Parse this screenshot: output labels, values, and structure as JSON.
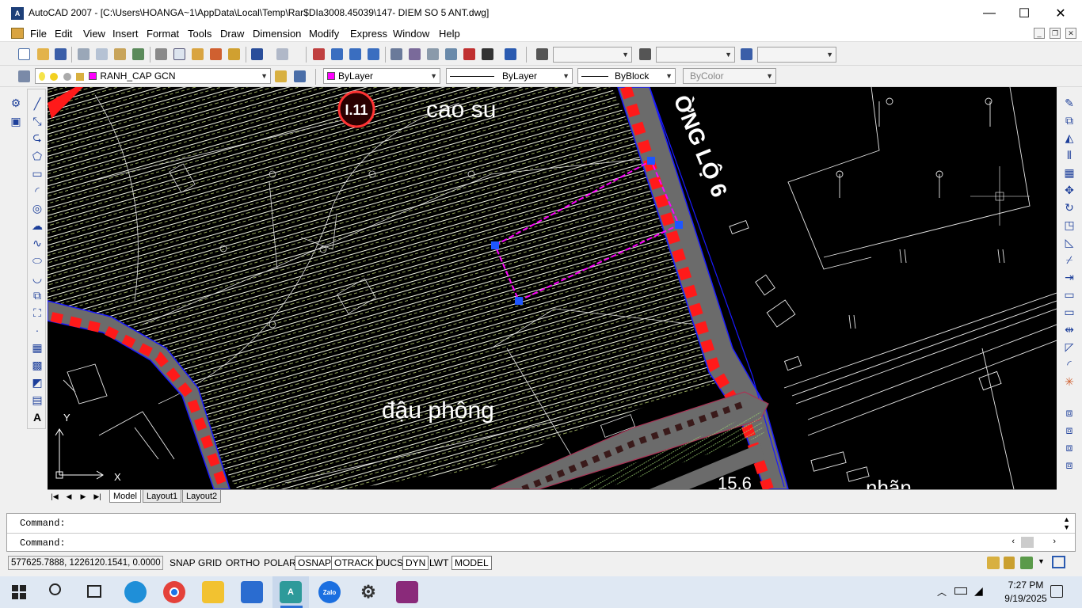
{
  "window": {
    "app_icon_text": "A",
    "title": "AutoCAD 2007 - [C:\\Users\\HOANGA~1\\AppData\\Local\\Temp\\Rar$DIa3008.45039\\147- DIEM SO 5 ANT.dwg]",
    "minimize": "—",
    "maximize": "☐",
    "close": "✕"
  },
  "menu": {
    "items": [
      "File",
      "Edit",
      "View",
      "Insert",
      "Format",
      "Tools",
      "Draw",
      "Dimension",
      "Modify",
      "Express",
      "Window",
      "Help"
    ],
    "mdi_minimize": "_",
    "mdi_restore": "❐",
    "mdi_close": "✕"
  },
  "properties_toolbar": {
    "layer": "RANH_CAP GCN",
    "color": "ByLayer",
    "linetype": "ByLayer",
    "lineweight": "ByBlock",
    "plotstyle": "ByColor",
    "color_swatch": "#ff00ff"
  },
  "drawing": {
    "labels": {
      "marker": "I.11",
      "cao_su": "cao su",
      "road": "ỜNG LỘ 6",
      "dau_phong": "đậu phộng",
      "number": "15.6",
      "nhan": "nhãn"
    },
    "ucs_x": "X",
    "ucs_y": "Y",
    "colors": {
      "background": "#000000",
      "hatch": "#e8f2c8",
      "road": "#6b6b6b",
      "road_dash": "#ff1a1a",
      "boundary": "#ff00ff",
      "grip": "#1e56ff",
      "road_edge": "#1a1aff"
    }
  },
  "layout_tabs": {
    "nav": [
      "|◀",
      "◀",
      "▶",
      "▶|"
    ],
    "tabs": [
      "Model",
      "Layout1",
      "Layout2"
    ],
    "active": "Model"
  },
  "command": {
    "line1": "Command:",
    "line2": "Command:"
  },
  "status": {
    "coords": "577625.7888, 1226120.1541, 0.0000",
    "buttons": [
      "SNAP",
      "GRID",
      "ORTHO",
      "POLAR",
      "OSNAP",
      "OTRACK",
      "DUCS",
      "DYN",
      "LWT",
      "MODEL"
    ]
  },
  "taskbar": {
    "apps": [
      "Start",
      "Search",
      "Task View",
      "Edge",
      "Chrome",
      "File Explorer",
      "Microsoft Store",
      "AutoCAD",
      "Zalo",
      "Settings",
      "WinRAR"
    ],
    "time": "7:27 PM",
    "date": "9/19/2025"
  }
}
